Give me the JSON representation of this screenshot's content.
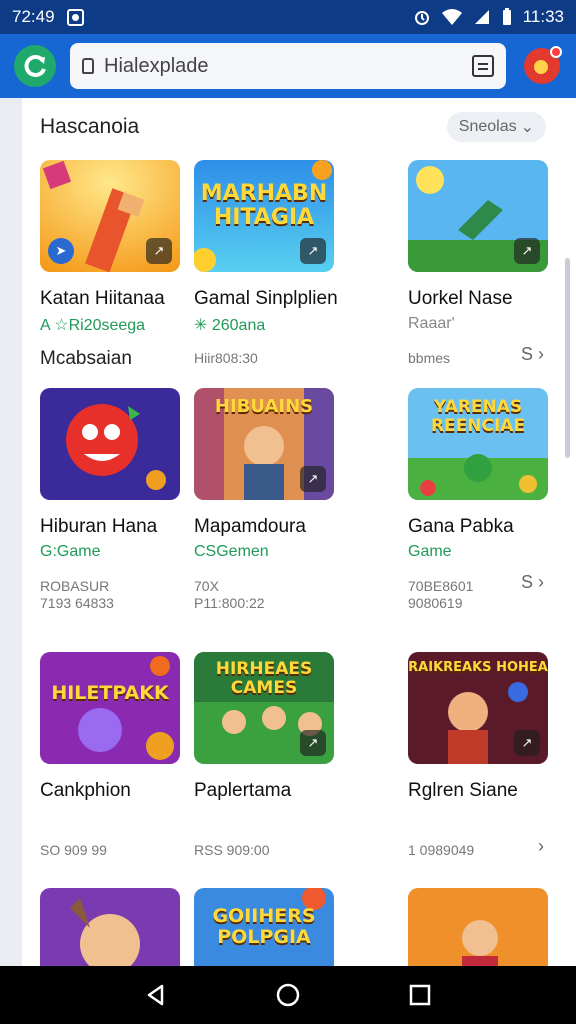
{
  "status": {
    "time": "72:49",
    "clock": "11:33"
  },
  "appbar": {
    "search_text": "Hialexplade"
  },
  "section": {
    "title": "Hascanoia",
    "action": "Sneolas"
  },
  "cards": [
    {
      "title": "Katan Hiitanaa",
      "sub": "A ☆Ri20seega",
      "meta": "Mcabsaian",
      "meta_style": "big",
      "art": "art1",
      "art_text": ""
    },
    {
      "title": "Gamal Sinplplien",
      "sub": "✳ 260ana",
      "meta": "Hiir808:30",
      "art": "art2",
      "art_text": "MARHABN HITAGIA"
    },
    {
      "title": "Uorkel Nase",
      "sub": "Raaar'",
      "sub_style": "gray",
      "meta": "bbmes",
      "arrow": "S ›",
      "art": "art3",
      "art_text": ""
    },
    {
      "title": "Hiburan Hana",
      "sub": "G:Game",
      "meta": "ROBASUR\n7193 64833",
      "art": "art4",
      "art_text": ""
    },
    {
      "title": "Mapamdoura",
      "sub": "CSGemen",
      "meta": "70X\nP11:800:22",
      "art": "art5",
      "art_text": "HIBUAINS"
    },
    {
      "title": "Gana Pabka",
      "sub": "Game",
      "meta": "70BE8601\n9080619",
      "arrow": "S ›",
      "art": "art6",
      "art_text": "YARENAS REENCIAE"
    },
    {
      "title": "Cankphion",
      "sub": "",
      "meta": "SO 909 99",
      "art": "art7",
      "art_text": "HILETPAKK"
    },
    {
      "title": "Paplertama",
      "sub": "",
      "meta": "RSS 909:00",
      "art": "art8",
      "art_text": "HIRHEAES CAMES"
    },
    {
      "title": "Rglren Siane",
      "sub": "",
      "meta": "1 0989049",
      "arrow": "›",
      "art": "art9",
      "art_text": "RAIKREAKS HOHEA"
    },
    {
      "title": "",
      "sub": "",
      "meta": "",
      "art": "art10",
      "art_text": ""
    },
    {
      "title": "",
      "sub": "",
      "meta": "",
      "art": "art11",
      "art_text": "GOIIHERS POLPGIA"
    },
    {
      "title": "",
      "sub": "",
      "meta": "",
      "art": "art12",
      "art_text": ""
    }
  ],
  "colors": {
    "appbar": "#1667d4",
    "statusbar": "#0d3b86",
    "accent_green": "#1f9a57"
  }
}
